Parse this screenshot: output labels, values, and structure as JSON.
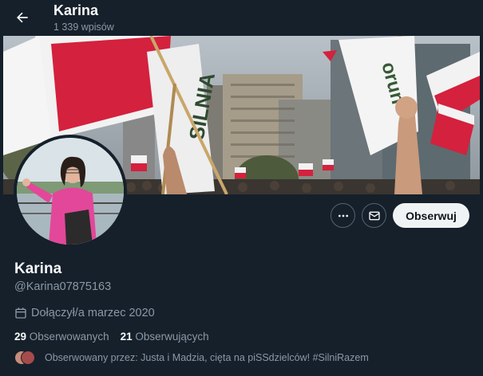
{
  "header": {
    "name": "Karina",
    "post_count": "1 339 wpisów"
  },
  "icons": {
    "back": "arrow-left-icon",
    "more": "more-horizontal-icon",
    "message": "envelope-icon",
    "calendar": "calendar-icon"
  },
  "actions": {
    "follow_label": "Obserwuj"
  },
  "profile": {
    "display_name": "Karina",
    "handle": "@Karina07875163",
    "joined": "Dołączył/a marzec 2020"
  },
  "stats": {
    "following_count": "29",
    "following_label": "Obserwowanych",
    "followers_count": "21",
    "followers_label": "Obserwujących"
  },
  "followed_by": {
    "text": "Obserwowany przez: Justa i Madzia, cięta na piSSdzielców! #SilniRazem"
  },
  "banner": {
    "flag_texts": [
      "SILNIA",
      "orun"
    ]
  },
  "colors": {
    "background": "#15202b",
    "text_primary": "#f7f9f9",
    "text_secondary": "#8b98a5",
    "button_bg": "#eff3f4",
    "flag_red": "#d4213d"
  }
}
